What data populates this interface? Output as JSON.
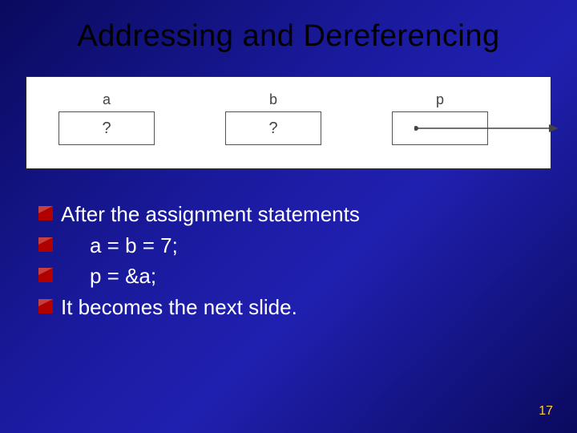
{
  "slide": {
    "title": "Addressing and Dereferencing",
    "page_number": "17"
  },
  "diagram": {
    "a": {
      "label": "a",
      "value": "?"
    },
    "b": {
      "label": "b",
      "value": "?"
    },
    "p": {
      "label": "p",
      "value": ""
    }
  },
  "bullets": {
    "line1": "After the assignment statements",
    "line2": "a  =  b  =  7;",
    "line3": "p  =  &a;",
    "line4": "It becomes the next slide."
  }
}
